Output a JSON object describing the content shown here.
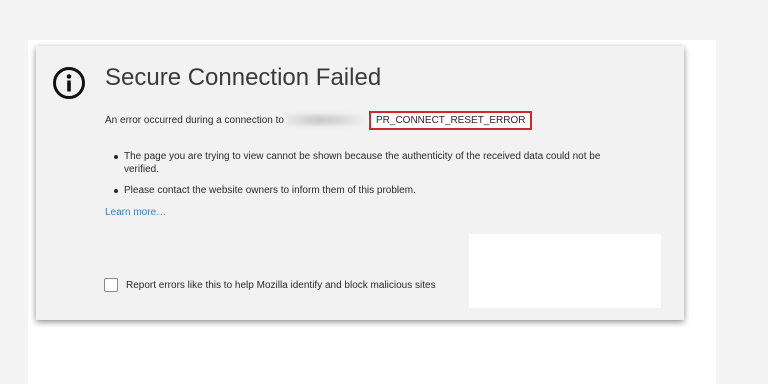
{
  "page": {
    "title": "Secure Connection Failed",
    "error_prefix": "An error occurred during a connection to",
    "error_code": "PR_CONNECT_RESET_ERROR",
    "bullets": [
      "The page you are trying to view cannot be shown because the authenticity of the received data could not be verified.",
      "Please contact the website owners to inform them of this problem."
    ],
    "learn_more": "Learn more…",
    "report_label": "Report errors like this to help Mozilla identify and block malicious sites",
    "report_checked": false
  },
  "icons": {
    "info": "info-circle-icon"
  },
  "colors": {
    "highlight_border": "#d0262d",
    "link": "#2f7fd1",
    "panel_bg": "#f2f2f2"
  }
}
